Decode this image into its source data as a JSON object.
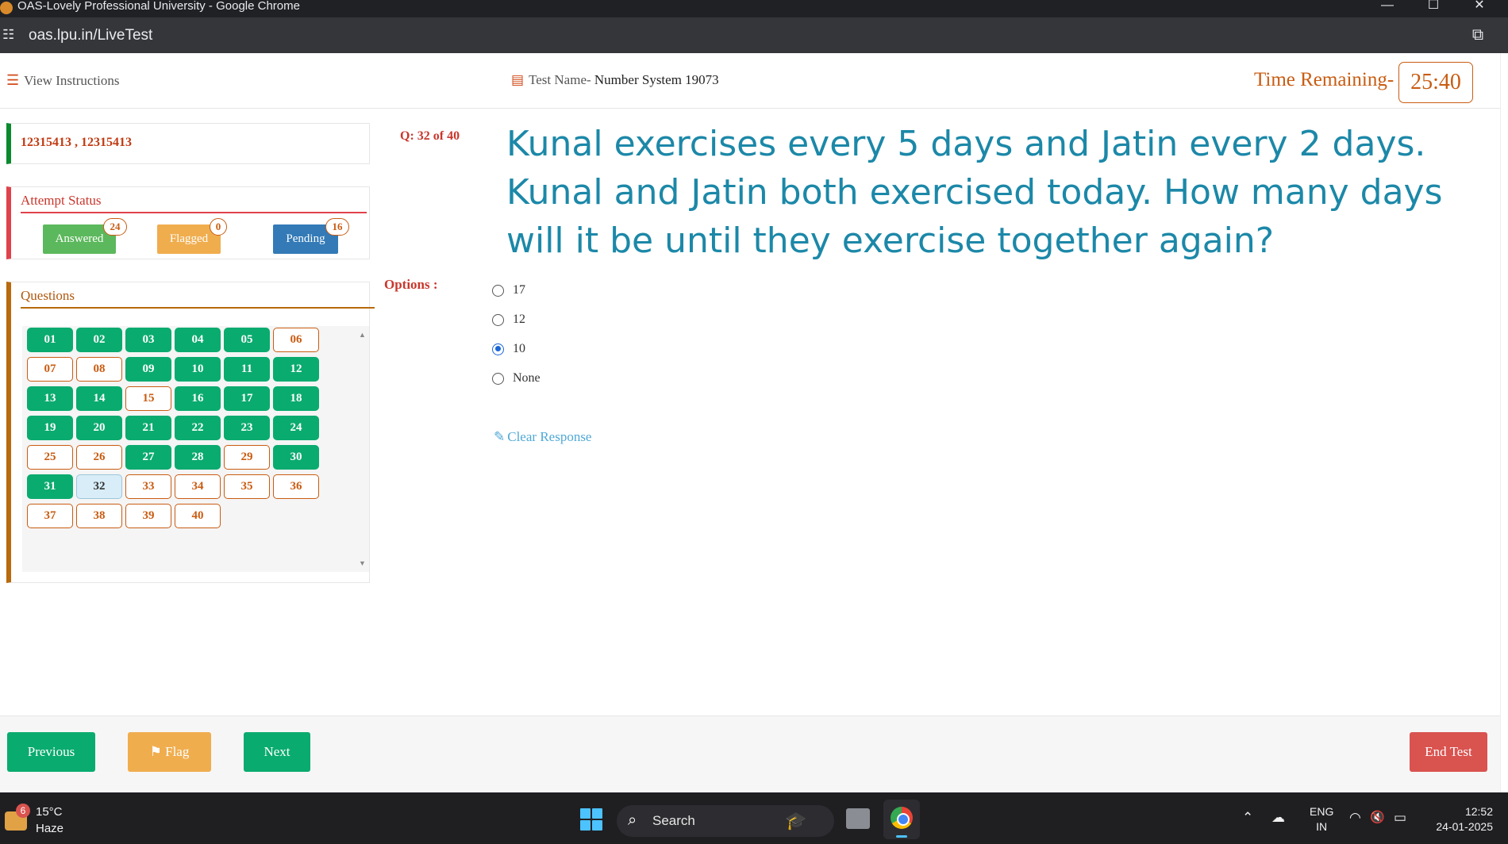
{
  "window": {
    "title": "OAS-Lovely Professional University - Google Chrome",
    "controls": {
      "minimize": "—",
      "maximize": "☐",
      "close": "✕"
    }
  },
  "addressbar": {
    "url": "oas.lpu.in/LiveTest",
    "tune_icon": "☷",
    "open_external_icon": "⧉"
  },
  "header": {
    "view_instructions": "View Instructions",
    "list_icon": "☰",
    "book_icon": "▤",
    "test_name_label": "Test Name-",
    "test_name_value": " Number System 19073",
    "time_label": "Time Remaining-",
    "time_value": "25:40"
  },
  "user": {
    "ids": "12315413 , 12315413"
  },
  "attempt_status": {
    "title": "Attempt Status",
    "answered": {
      "label": "Answered",
      "count": "24",
      "color": "#5cb85c"
    },
    "flagged": {
      "label": "Flagged",
      "count": "0",
      "color": "#f0ad4e"
    },
    "pending": {
      "label": "Pending",
      "count": "16",
      "color": "#337ab7"
    }
  },
  "questions_panel": {
    "title": "Questions",
    "scroll_up": "▲",
    "scroll_down": "▼",
    "items": [
      {
        "n": "01",
        "state": "answered"
      },
      {
        "n": "02",
        "state": "answered"
      },
      {
        "n": "03",
        "state": "answered"
      },
      {
        "n": "04",
        "state": "answered"
      },
      {
        "n": "05",
        "state": "answered"
      },
      {
        "n": "06",
        "state": "pending"
      },
      {
        "n": "07",
        "state": "pending"
      },
      {
        "n": "08",
        "state": "pending"
      },
      {
        "n": "09",
        "state": "answered"
      },
      {
        "n": "10",
        "state": "answered"
      },
      {
        "n": "11",
        "state": "answered"
      },
      {
        "n": "12",
        "state": "answered"
      },
      {
        "n": "13",
        "state": "answered"
      },
      {
        "n": "14",
        "state": "answered"
      },
      {
        "n": "15",
        "state": "pending"
      },
      {
        "n": "16",
        "state": "answered"
      },
      {
        "n": "17",
        "state": "answered"
      },
      {
        "n": "18",
        "state": "answered"
      },
      {
        "n": "19",
        "state": "answered"
      },
      {
        "n": "20",
        "state": "answered"
      },
      {
        "n": "21",
        "state": "answered"
      },
      {
        "n": "22",
        "state": "answered"
      },
      {
        "n": "23",
        "state": "answered"
      },
      {
        "n": "24",
        "state": "answered"
      },
      {
        "n": "25",
        "state": "pending"
      },
      {
        "n": "26",
        "state": "pending"
      },
      {
        "n": "27",
        "state": "answered"
      },
      {
        "n": "28",
        "state": "answered"
      },
      {
        "n": "29",
        "state": "pending"
      },
      {
        "n": "30",
        "state": "answered"
      },
      {
        "n": "31",
        "state": "answered"
      },
      {
        "n": "32",
        "state": "current"
      },
      {
        "n": "33",
        "state": "pending"
      },
      {
        "n": "34",
        "state": "pending"
      },
      {
        "n": "35",
        "state": "pending"
      },
      {
        "n": "36",
        "state": "pending"
      },
      {
        "n": "37",
        "state": "pending"
      },
      {
        "n": "38",
        "state": "pending"
      },
      {
        "n": "39",
        "state": "pending"
      },
      {
        "n": "40",
        "state": "pending"
      }
    ]
  },
  "question": {
    "number": "Q: 32 of 40",
    "text": "Kunal exercises every 5 days and Jatin every 2 days. Kunal and Jatin both exercised today. How many days will it be until they exercise together again?",
    "options_label": "Options :",
    "options": [
      {
        "label": "17",
        "selected": false
      },
      {
        "label": "12",
        "selected": false
      },
      {
        "label": "10",
        "selected": true
      },
      {
        "label": "None",
        "selected": false
      }
    ],
    "clear_icon": "✎",
    "clear_response": "Clear Response"
  },
  "footer": {
    "previous": "Previous",
    "flag_icon": "⚑",
    "flag": "Flag",
    "next": "Next",
    "end_test": "End Test",
    "colors": {
      "green": "#0aab6f",
      "orange": "#f0ad4e",
      "red": "#d9534f"
    }
  },
  "taskbar": {
    "weather_badge": "6",
    "temperature": "15°C",
    "condition": "Haze",
    "search_icon": "⌕",
    "search_label": "Search",
    "hat_icon": "🎓",
    "tray_chevron": "⌃",
    "cloud_icon": "☁",
    "lang_top": "ENG",
    "lang_bottom": "IN",
    "wifi_icon": "◠",
    "mute_icon": "🔇",
    "battery_icon": "▭",
    "time": "12:52",
    "date": "24-01-2025"
  }
}
